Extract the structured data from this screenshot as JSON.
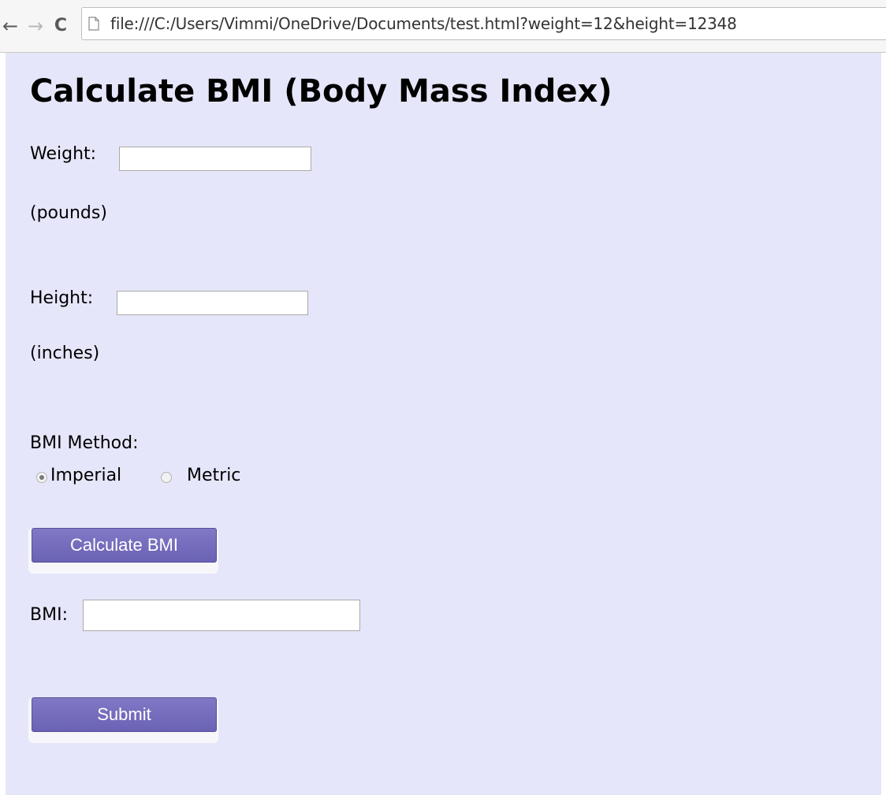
{
  "browser": {
    "back_glyph": "←",
    "forward_glyph": "→",
    "reload_glyph": "C",
    "url": "file:///C:/Users/Vimmi/OneDrive/Documents/test.html?weight=12&height=12348"
  },
  "page": {
    "title": "Calculate BMI (Body Mass Index)",
    "background_color": "#e6e6fa",
    "weight_label": "Weight:",
    "weight_value": "",
    "weight_unit": "(pounds)",
    "height_label": "Height:",
    "height_value": "",
    "height_unit": "(inches)",
    "method_label": "BMI Method:",
    "method_options": [
      {
        "label": "Imperial",
        "selected": true
      },
      {
        "label": "Metric",
        "selected": false
      }
    ],
    "calculate_button": "Calculate BMI",
    "bmi_label": "BMI:",
    "bmi_value": "",
    "submit_button": "Submit",
    "button_color": "#7068bd"
  },
  "icons": {
    "back": "back-arrow-icon",
    "forward": "forward-arrow-icon",
    "reload": "reload-icon",
    "page": "page-icon"
  }
}
